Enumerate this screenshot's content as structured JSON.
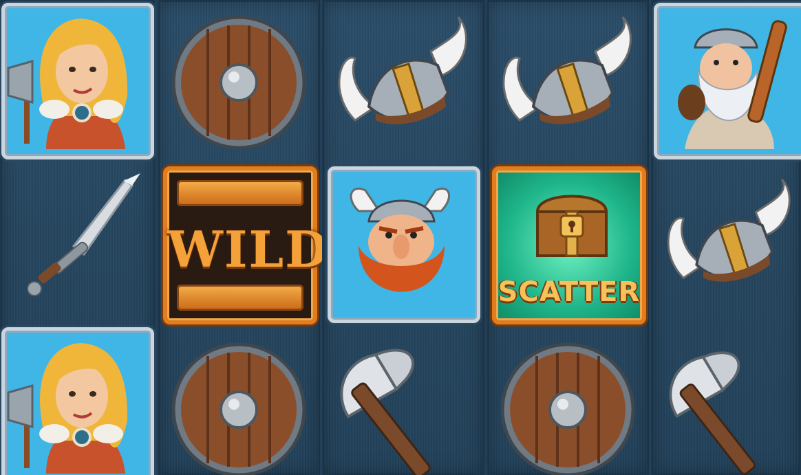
{
  "game": {
    "theme": "viking",
    "reels": [
      {
        "symbols": [
          "shieldmaiden-portrait",
          "sword",
          "shieldmaiden-portrait"
        ]
      },
      {
        "symbols": [
          "round-shield",
          "wild",
          "round-shield"
        ]
      },
      {
        "symbols": [
          "horned-helmet",
          "red-beard-viking-portrait",
          "battle-axe"
        ]
      },
      {
        "symbols": [
          "horned-helmet",
          "scatter-chest",
          "round-shield"
        ]
      },
      {
        "symbols": [
          "old-viking-portrait",
          "horned-helmet",
          "battle-axe"
        ]
      }
    ],
    "wild_label": "WILD",
    "scatter_label": "SCATTER"
  },
  "colors": {
    "reel_bg": "#26465f",
    "portrait_bg": "#3fb6e6",
    "frame_orange": "#e07d1e",
    "scatter_green": "#1fb58a"
  }
}
